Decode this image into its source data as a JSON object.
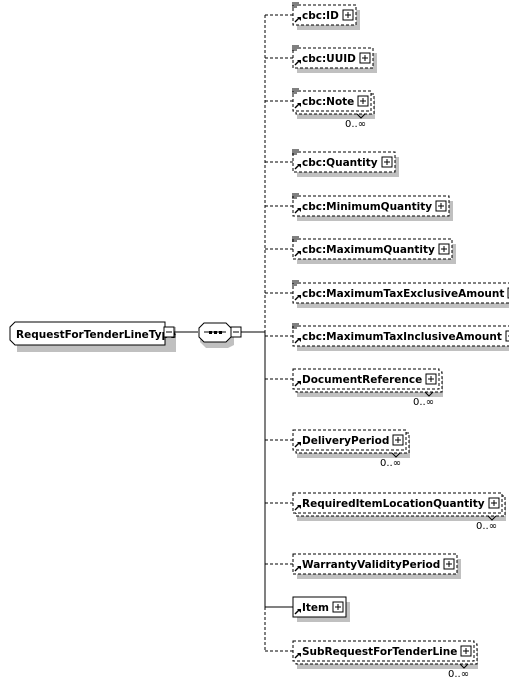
{
  "root": {
    "name": "RequestForTenderLineType",
    "compositor": "sequence",
    "collapse_symbol": "minus"
  },
  "colors": {
    "line": "#000000",
    "shadow": "#c0c0c0",
    "box_fill": "#ffffff",
    "text": "#000000"
  },
  "elements": [
    {
      "name": "cbc:ID",
      "optional": true,
      "repeating": false,
      "occurrence": "",
      "has_doc_icon": true
    },
    {
      "name": "cbc:UUID",
      "optional": true,
      "repeating": false,
      "occurrence": "",
      "has_doc_icon": true
    },
    {
      "name": "cbc:Note",
      "optional": true,
      "repeating": true,
      "occurrence": "0..∞",
      "has_doc_icon": true
    },
    {
      "name": "cbc:Quantity",
      "optional": true,
      "repeating": false,
      "occurrence": "",
      "has_doc_icon": true
    },
    {
      "name": "cbc:MinimumQuantity",
      "optional": true,
      "repeating": false,
      "occurrence": "",
      "has_doc_icon": true
    },
    {
      "name": "cbc:MaximumQuantity",
      "optional": true,
      "repeating": false,
      "occurrence": "",
      "has_doc_icon": true
    },
    {
      "name": "cbc:MaximumTaxExclusiveAmount",
      "optional": true,
      "repeating": false,
      "occurrence": "",
      "has_doc_icon": true
    },
    {
      "name": "cbc:MaximumTaxInclusiveAmount",
      "optional": true,
      "repeating": false,
      "occurrence": "",
      "has_doc_icon": true
    },
    {
      "name": "DocumentReference",
      "optional": true,
      "repeating": true,
      "occurrence": "0..∞",
      "has_doc_icon": false
    },
    {
      "name": "DeliveryPeriod",
      "optional": true,
      "repeating": true,
      "occurrence": "0..∞",
      "has_doc_icon": false
    },
    {
      "name": "RequiredItemLocationQuantity",
      "optional": true,
      "repeating": true,
      "occurrence": "0..∞",
      "has_doc_icon": false
    },
    {
      "name": "WarrantyValidityPeriod",
      "optional": true,
      "repeating": false,
      "occurrence": "",
      "has_doc_icon": false
    },
    {
      "name": "Item",
      "optional": false,
      "repeating": false,
      "occurrence": "",
      "has_doc_icon": false
    },
    {
      "name": "SubRequestForTenderLine",
      "optional": true,
      "repeating": true,
      "occurrence": "0..∞",
      "has_doc_icon": false
    }
  ]
}
